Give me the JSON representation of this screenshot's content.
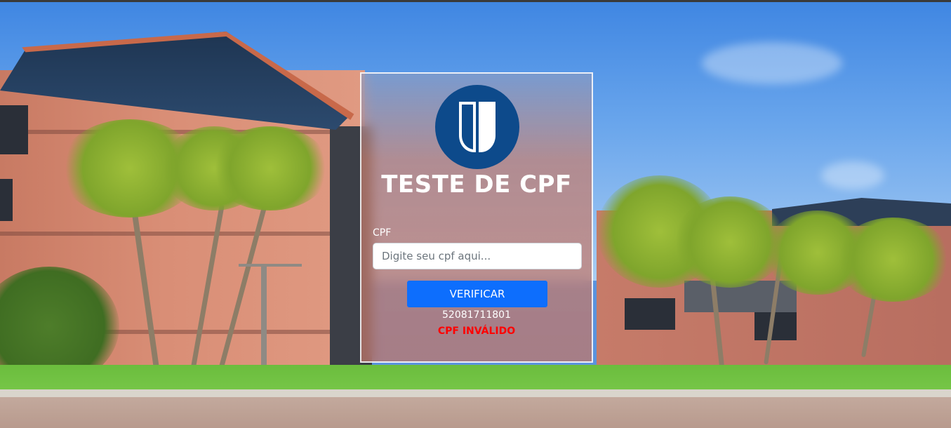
{
  "card": {
    "title": "TESTE DE CPF",
    "logo_icon": "university-u-logo-icon",
    "cpf_label": "CPF",
    "cpf_input": {
      "value": "",
      "placeholder": "Digite seu cpf aqui..."
    },
    "verify_button_label": "VERIFICAR",
    "result_cpf": "52081711801",
    "result_status": "CPF INVÁLIDO"
  },
  "colors": {
    "logo_background": "#0d4a8b",
    "button_primary": "#0d6efd",
    "status_invalid": "#ff0000"
  }
}
